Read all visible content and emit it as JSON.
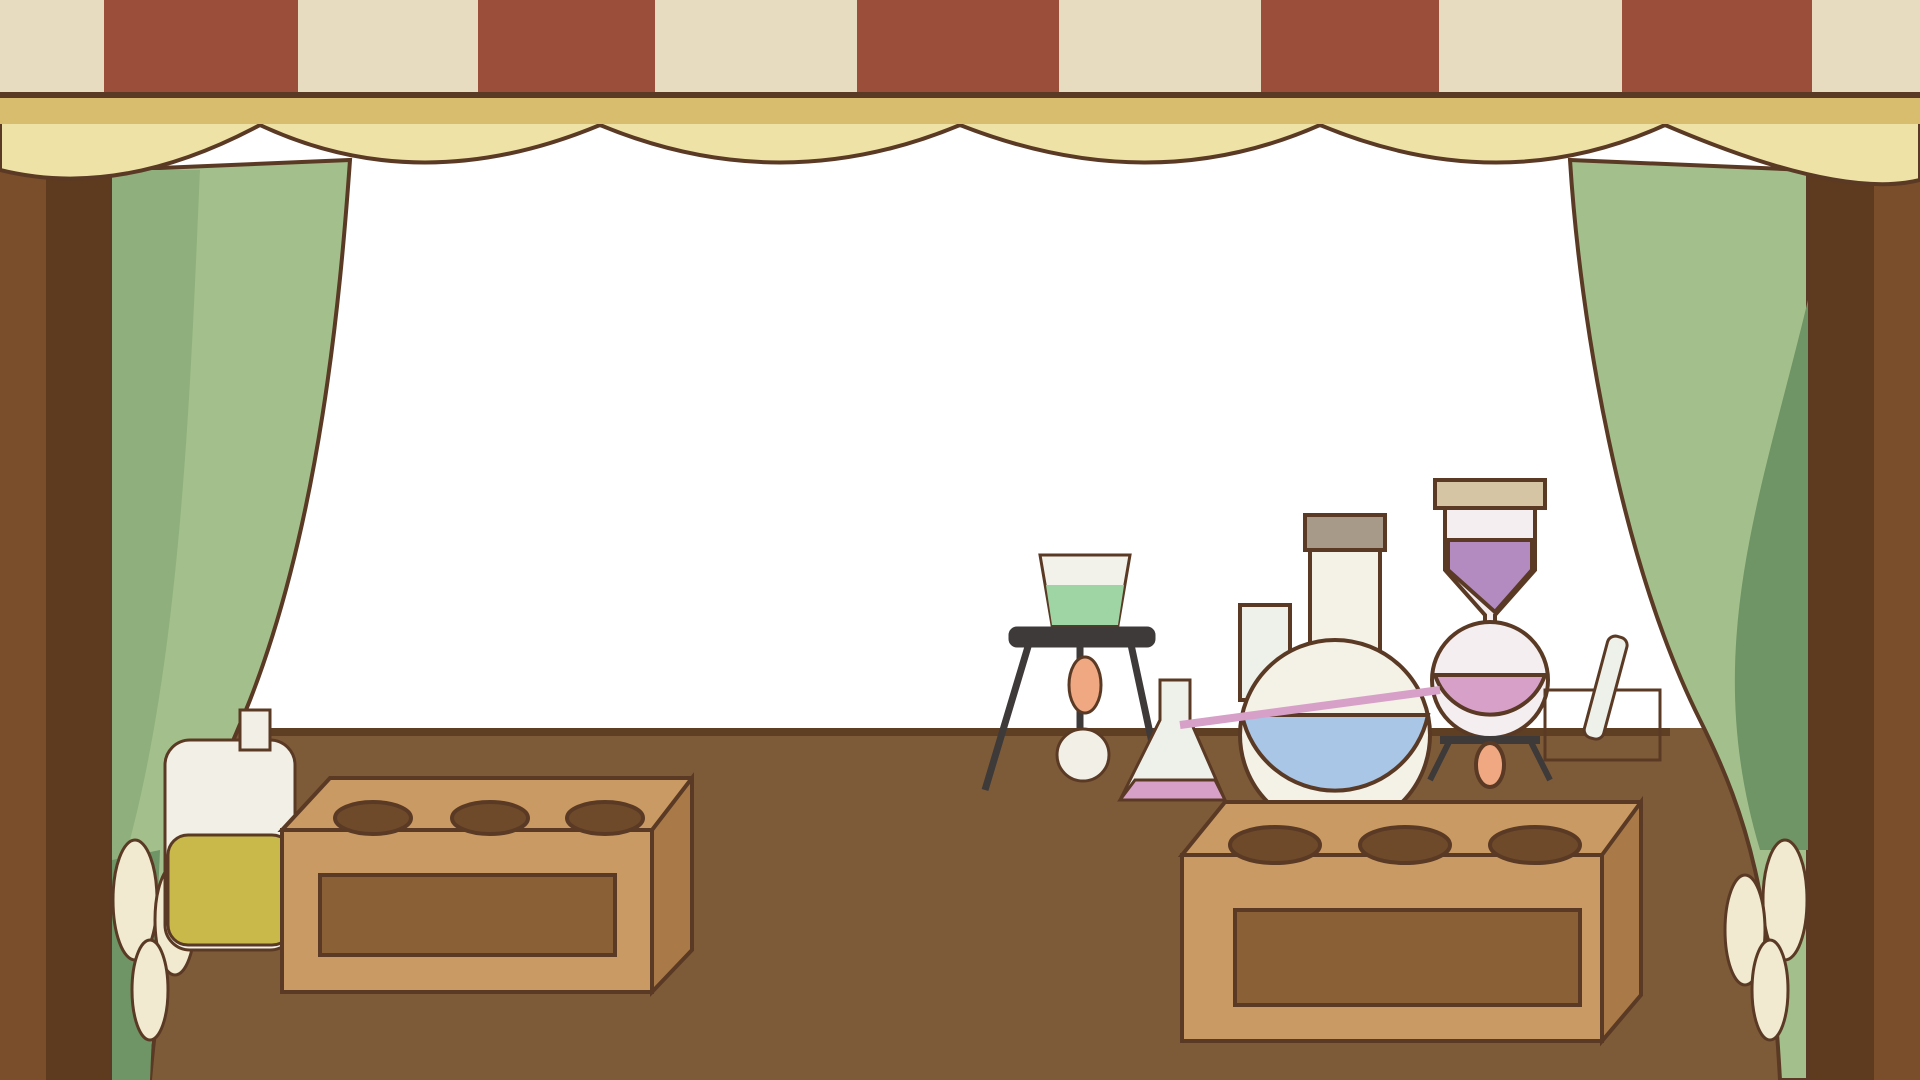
{
  "scene": {
    "name": "alchemy-stage",
    "colors": {
      "awning_red": "#9b4f3a",
      "awning_cream": "#e8dcc0",
      "valance": "#efe2a6",
      "valance_band": "#d9bd6f",
      "post": "#7a4e2a",
      "post_dark": "#5e3a1f",
      "curtain": "#a3c08c",
      "curtain_dark": "#6f9466",
      "backdrop": "#ffffff",
      "table": "#7e5b38",
      "rack": "#c99a63",
      "rack_side": "#a97a48",
      "outline": "#5a3a24",
      "liquid_blue": "#a9c6e6",
      "liquid_pink": "#d7a0c8",
      "liquid_green": "#9fd4a5",
      "liquid_yellow": "#c9b94a"
    },
    "items": [
      "striped-awning",
      "scalloped-valance",
      "left-curtain",
      "right-curtain",
      "test-tube-rack-left",
      "test-tube-rack-right",
      "yellow-potion-bottle",
      "tripod-with-beaker",
      "round-flask-blue",
      "hourglass-flask-pink",
      "conical-flask",
      "test-tube-holder"
    ]
  }
}
